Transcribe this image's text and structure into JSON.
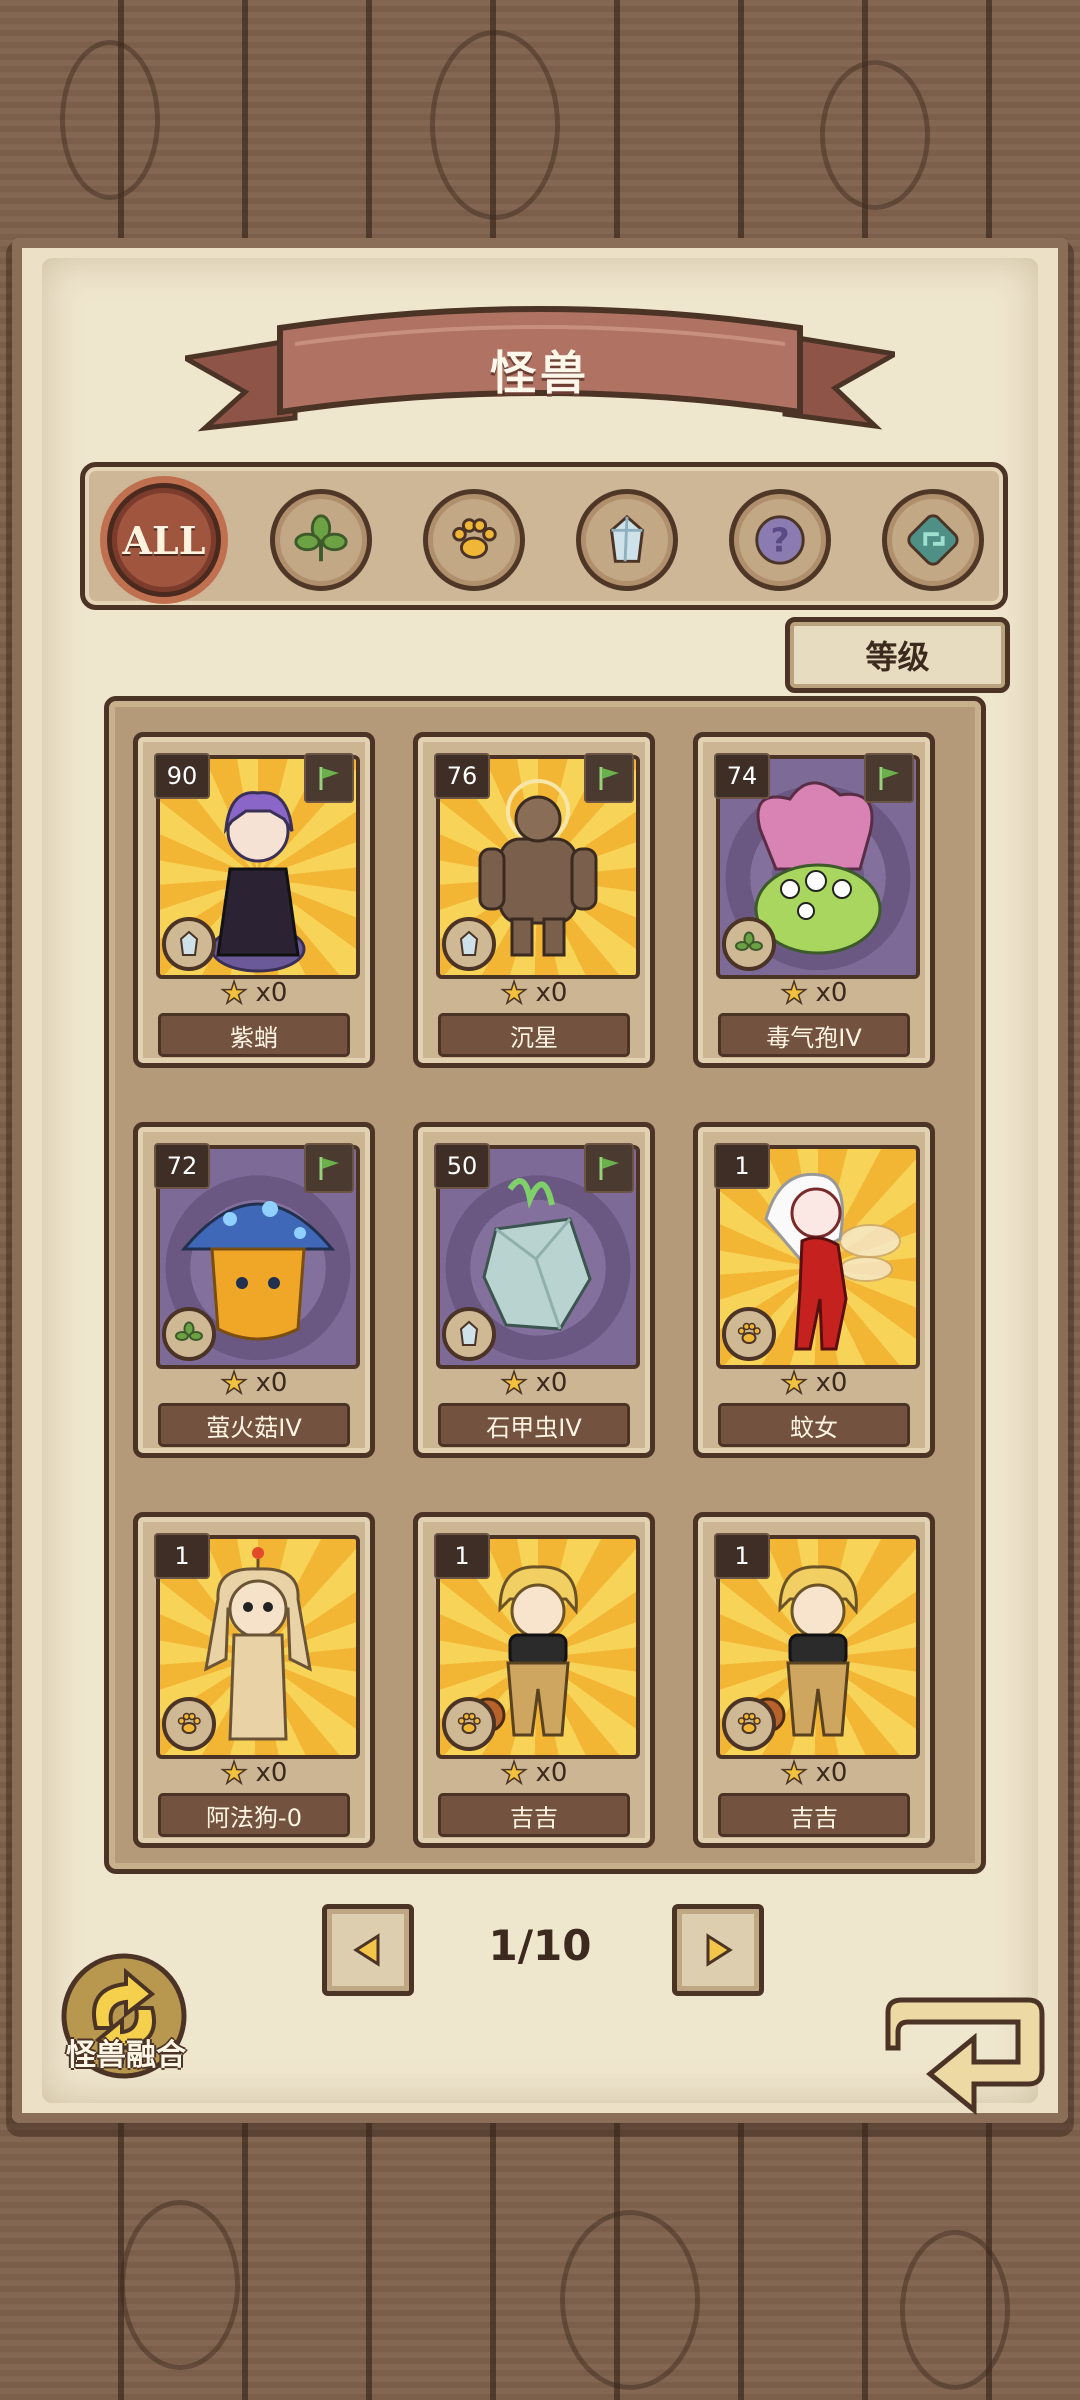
{
  "header": {
    "title": "怪兽"
  },
  "filters": [
    {
      "id": "all",
      "label": "ALL",
      "icon": "all-icon",
      "active": true
    },
    {
      "id": "plant",
      "icon": "leaf-icon"
    },
    {
      "id": "beast",
      "icon": "paw-icon"
    },
    {
      "id": "mineral",
      "icon": "crystal-icon"
    },
    {
      "id": "unknown",
      "icon": "question-icon"
    },
    {
      "id": "mechanical",
      "icon": "gear-arrow-icon"
    }
  ],
  "sort": {
    "label": "等级"
  },
  "cards": [
    {
      "level": "90",
      "name": "紫蛸",
      "stars": "x0",
      "bg": "sun",
      "element": "crystal-icon",
      "flag": true
    },
    {
      "level": "76",
      "name": "沉星",
      "stars": "x0",
      "bg": "sun",
      "element": "crystal-icon",
      "flag": true
    },
    {
      "level": "74",
      "name": "毒气孢IV",
      "stars": "x0",
      "bg": "purple",
      "element": "leaf-icon",
      "flag": true
    },
    {
      "level": "72",
      "name": "萤火菇IV",
      "stars": "x0",
      "bg": "purple",
      "element": "leaf-icon",
      "flag": true
    },
    {
      "level": "50",
      "name": "石甲虫IV",
      "stars": "x0",
      "bg": "purple",
      "element": "crystal-icon",
      "flag": true
    },
    {
      "level": "1",
      "name": "蚊女",
      "stars": "x0",
      "bg": "sun",
      "element": "paw-icon",
      "flag": false
    },
    {
      "level": "1",
      "name": "阿法狗-0",
      "stars": "x0",
      "bg": "sun",
      "element": "paw-icon",
      "flag": false
    },
    {
      "level": "1",
      "name": "吉吉",
      "stars": "x0",
      "bg": "sun",
      "element": "paw-icon",
      "flag": false
    },
    {
      "level": "1",
      "name": "吉吉",
      "stars": "x0",
      "bg": "sun",
      "element": "paw-icon",
      "flag": false
    }
  ],
  "pager": {
    "text": "1/10",
    "current": 1,
    "total": 10
  },
  "fusion": {
    "label": "怪兽融合"
  },
  "colors": {
    "ribbon": "#a8685a",
    "wood": "#7b5f4a",
    "paper": "#ece1c7",
    "accent": "#f2c13d"
  }
}
